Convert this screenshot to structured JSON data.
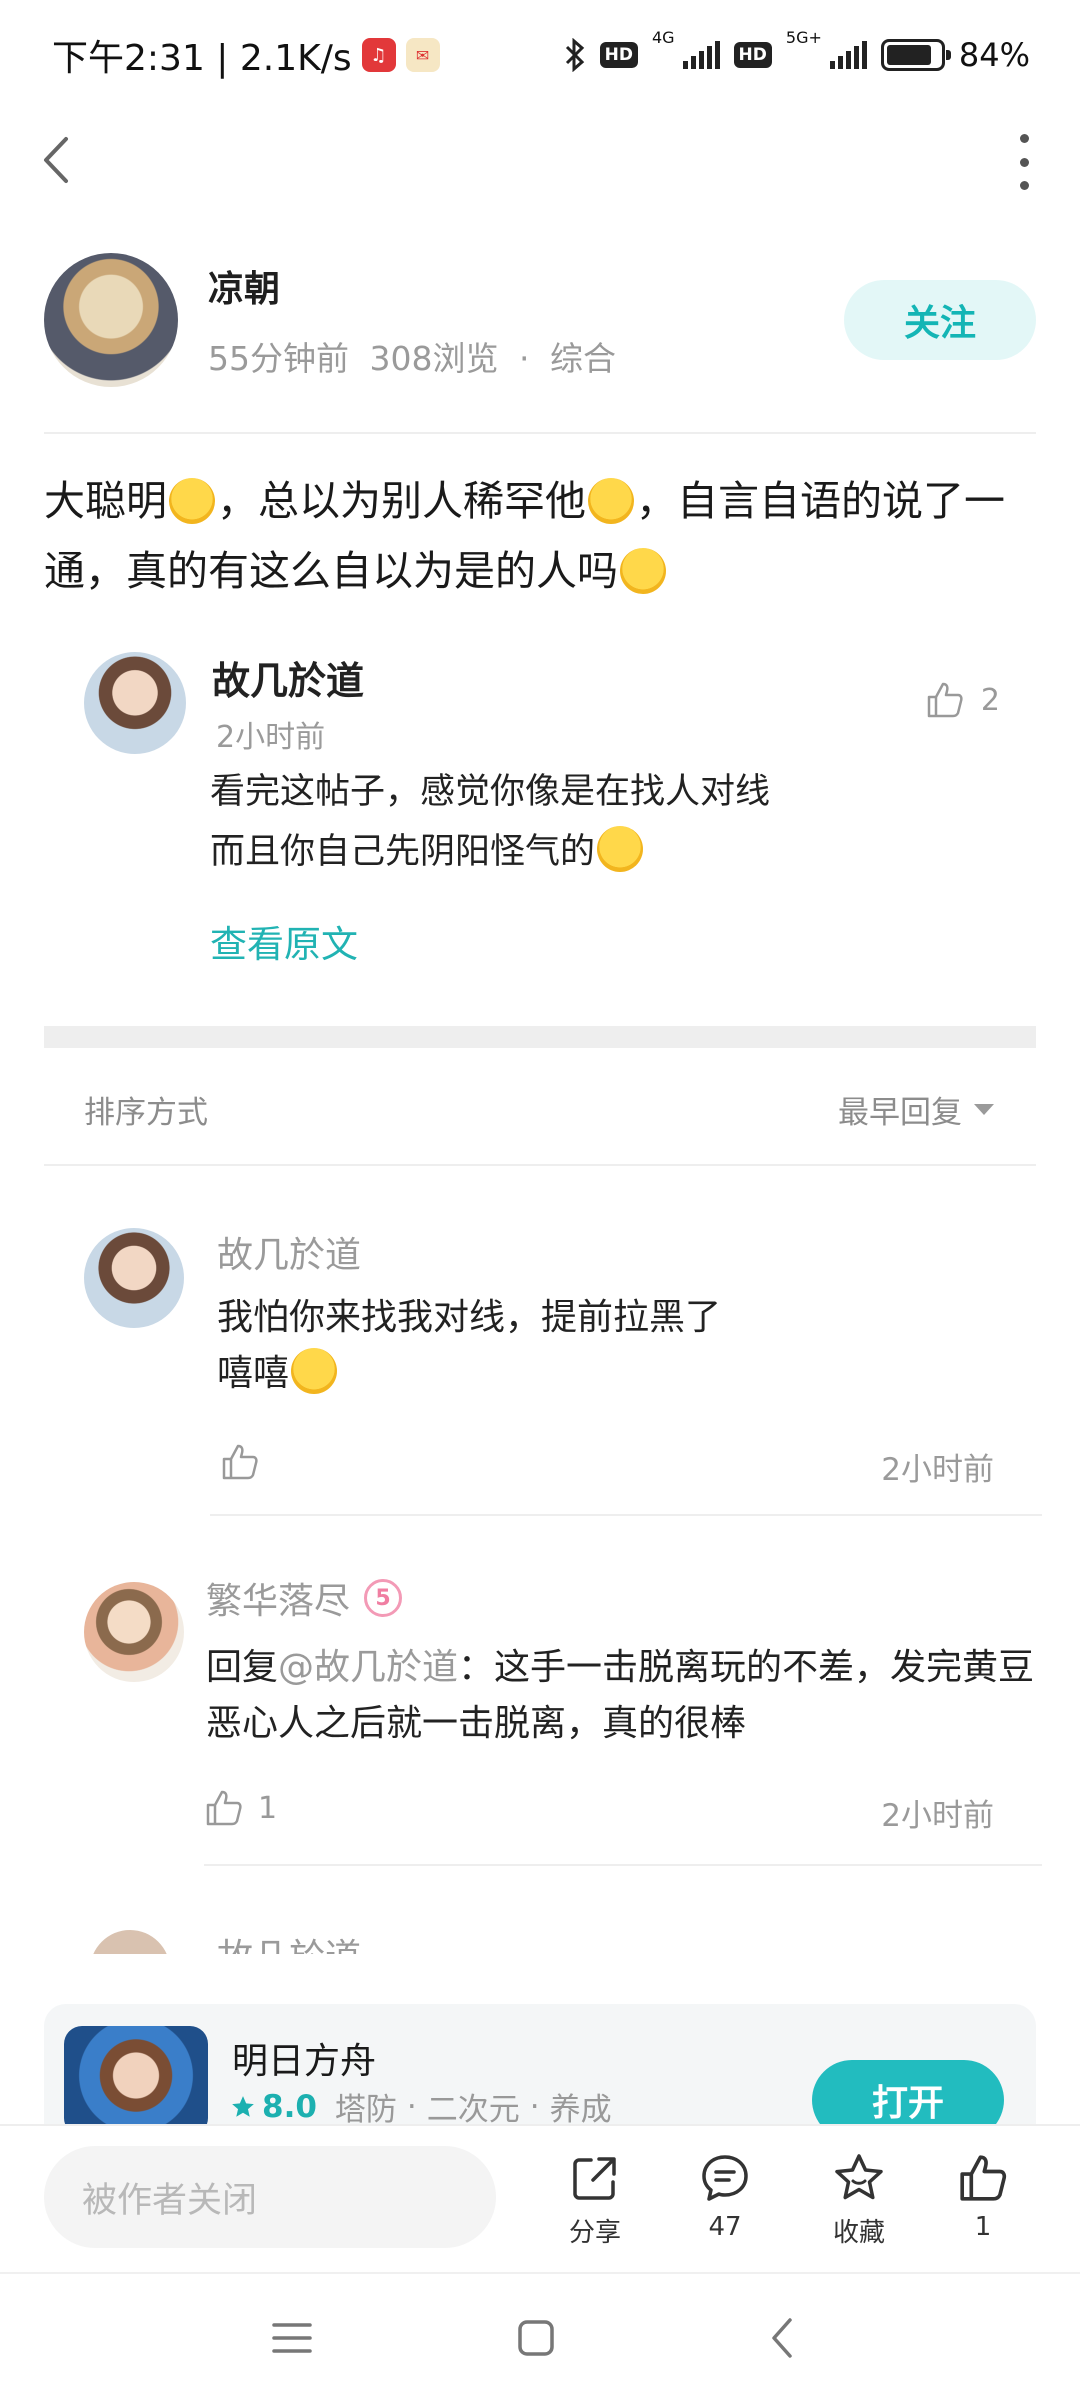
{
  "status_bar": {
    "time_speed": "下午2:31 | 2.1K/s",
    "network_1": "4G",
    "network_2": "5G+",
    "hd": "HD",
    "battery": "84%"
  },
  "post": {
    "author_name": "凉朝",
    "time_ago": "55分钟前",
    "views": "308浏览",
    "separator": "·",
    "category": "综合",
    "follow_label": "关注",
    "content_part1": "大聪明",
    "content_part2": "，总以为别人稀罕他",
    "content_part3": "，自言自语的说了一通，真的有这么自以为是的人吗"
  },
  "quote": {
    "name": "故几於道",
    "time": "2小时前",
    "like_count": "2",
    "line1": "看完这帖子，感觉你像是在找人对线",
    "line2": "而且你自己先阴阳怪气的",
    "view_original": "查看原文"
  },
  "sort": {
    "label": "排序方式",
    "value": "最早回复"
  },
  "comments": [
    {
      "name": "故几於道",
      "line1": "我怕你来找我对线，提前拉黑了",
      "line2": "嘻嘻",
      "likes": "",
      "time": "2小时前"
    },
    {
      "name": "繁华落尽",
      "level": "5",
      "reply_prefix": "回复",
      "mention": "@故几於道",
      "reply_text": "：这手一击脱离玩的不差，发完黄豆恶心人之后就一击脱离，真的很棒",
      "likes": "1",
      "time": "2小时前"
    }
  ],
  "partial_comment_name": "故几於道",
  "game": {
    "name": "明日方舟",
    "score": "8.0",
    "tags": [
      "塔防",
      "二次元",
      "养成"
    ],
    "open_label": "打开"
  },
  "bottom_bar": {
    "input_placeholder": "被作者关闭",
    "share_label": "分享",
    "comment_count": "47",
    "favorite_label": "收藏",
    "like_count": "1"
  }
}
